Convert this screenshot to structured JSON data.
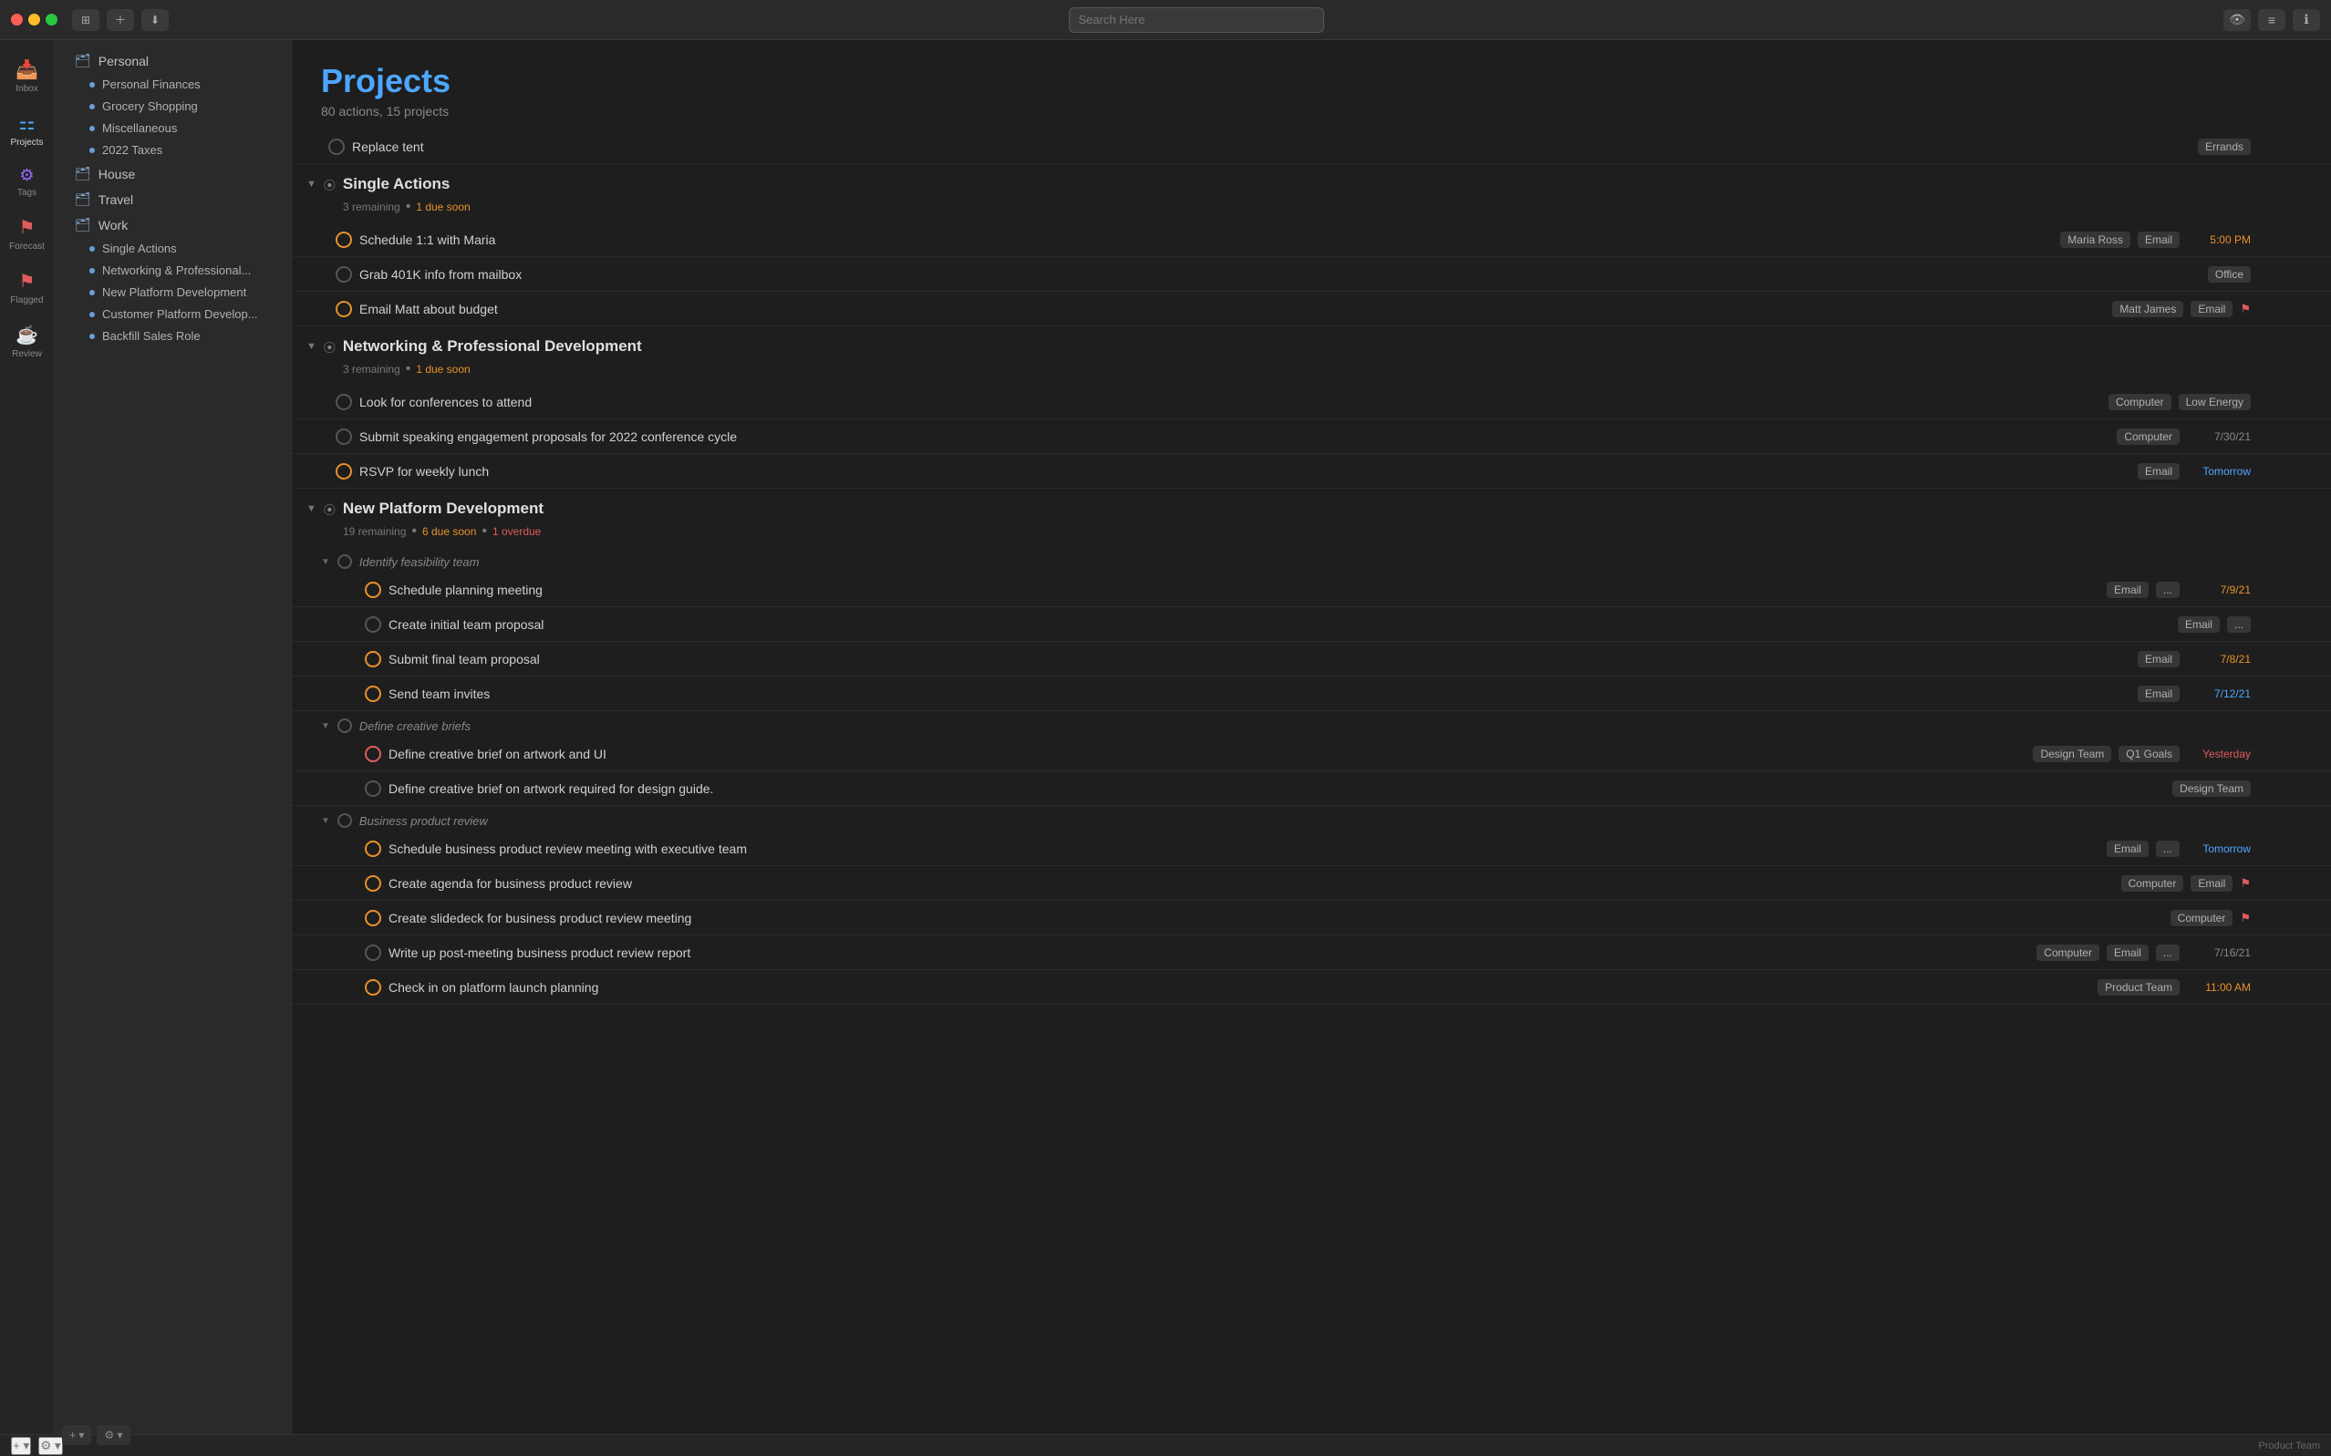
{
  "titlebar": {
    "search_placeholder": "Search Here",
    "buttons": [
      "⊞",
      "＋",
      "⬇"
    ]
  },
  "icon_sidebar": {
    "items": [
      {
        "id": "inbox",
        "icon": "📥",
        "label": "Inbox"
      },
      {
        "id": "projects",
        "icon": "⚏",
        "label": "Projects",
        "active": true
      },
      {
        "id": "tags",
        "icon": "⚙",
        "label": "Tags"
      },
      {
        "id": "forecast",
        "icon": "⚑",
        "label": "Forecast"
      },
      {
        "id": "flagged",
        "icon": "⚑",
        "label": "Flagged"
      },
      {
        "id": "review",
        "icon": "☕",
        "label": "Review"
      }
    ]
  },
  "nav_sidebar": {
    "personal_group": {
      "label": "Personal",
      "items": [
        {
          "label": "Personal Finances"
        },
        {
          "label": "Grocery Shopping"
        },
        {
          "label": "Miscellaneous"
        },
        {
          "label": "2022 Taxes"
        }
      ]
    },
    "house": {
      "label": "House"
    },
    "travel": {
      "label": "Travel"
    },
    "work_group": {
      "label": "Work",
      "items": [
        {
          "label": "Single Actions"
        },
        {
          "label": "Networking & Professional..."
        },
        {
          "label": "New Platform Development"
        },
        {
          "label": "Customer Platform Develop..."
        },
        {
          "label": "Backfill Sales Role"
        }
      ]
    }
  },
  "content": {
    "title": "Projects",
    "subtitle": "80 actions, 15 projects",
    "standalone_action": {
      "title": "Replace tent",
      "tags": [
        "Errands"
      ]
    },
    "sections": [
      {
        "id": "single-actions",
        "title": "Single Actions",
        "remaining": "3 remaining",
        "due_soon": "1 due soon",
        "actions": [
          {
            "title": "Schedule 1:1 with Maria",
            "tags": [
              "Maria Ross",
              "Email"
            ],
            "date": "5:00 PM",
            "date_class": "orange",
            "check_class": "orange",
            "flagged": false
          },
          {
            "title": "Grab 401K info from mailbox",
            "tags": [
              "Office"
            ],
            "date": "",
            "date_class": "",
            "check_class": "",
            "flagged": false
          },
          {
            "title": "Email Matt about budget",
            "tags": [
              "Matt James",
              "Email"
            ],
            "date": "",
            "date_class": "",
            "check_class": "orange",
            "flagged": true
          }
        ]
      },
      {
        "id": "networking",
        "title": "Networking & Professional Development",
        "remaining": "3 remaining",
        "due_soon": "1 due soon",
        "actions": [
          {
            "title": "Look for conferences to attend",
            "tags": [
              "Computer",
              "Low Energy"
            ],
            "date": "",
            "date_class": "",
            "check_class": "",
            "flagged": false
          },
          {
            "title": "Submit speaking engagement proposals for 2022 conference cycle",
            "tags": [
              "Computer"
            ],
            "date": "7/30/21",
            "date_class": "",
            "check_class": "",
            "flagged": false
          },
          {
            "title": "RSVP for weekly lunch",
            "tags": [
              "Email"
            ],
            "date": "Tomorrow",
            "date_class": "blue",
            "check_class": "orange",
            "flagged": false
          }
        ]
      },
      {
        "id": "new-platform-development",
        "title": "New Platform Development",
        "remaining": "19 remaining",
        "due_soon": "6 due soon",
        "overdue": "1 overdue",
        "sub_sections": [
          {
            "title": "Identify feasibility team",
            "actions": [
              {
                "title": "Schedule planning meeting",
                "tags": [
                  "Email",
                  "..."
                ],
                "date": "7/9/21",
                "date_class": "orange",
                "check_class": "orange",
                "flagged": false
              },
              {
                "title": "Create initial team proposal",
                "tags": [
                  "Email",
                  "..."
                ],
                "date": "",
                "date_class": "",
                "check_class": "",
                "flagged": false
              },
              {
                "title": "Submit final team proposal",
                "tags": [
                  "Email"
                ],
                "date": "7/8/21",
                "date_class": "orange",
                "check_class": "orange",
                "flagged": false
              },
              {
                "title": "Send team invites",
                "tags": [
                  "Email"
                ],
                "date": "7/12/21",
                "date_class": "blue",
                "check_class": "orange",
                "flagged": false
              }
            ]
          },
          {
            "title": "Define creative briefs",
            "actions": [
              {
                "title": "Define creative brief on artwork and UI",
                "tags": [
                  "Design Team",
                  "Q1 Goals"
                ],
                "date": "Yesterday",
                "date_class": "red",
                "check_class": "red",
                "flagged": false
              },
              {
                "title": "Define creative brief on artwork required for design guide.",
                "tags": [
                  "Design Team"
                ],
                "date": "",
                "date_class": "",
                "check_class": "",
                "flagged": false
              }
            ]
          },
          {
            "title": "Business product review",
            "actions": [
              {
                "title": "Schedule business product review meeting with executive team",
                "tags": [
                  "Email",
                  "..."
                ],
                "date": "Tomorrow",
                "date_class": "blue",
                "check_class": "orange",
                "flagged": false
              },
              {
                "title": "Create agenda for business product review",
                "tags": [
                  "Computer",
                  "Email"
                ],
                "date": "",
                "date_class": "",
                "check_class": "orange",
                "flagged": true
              },
              {
                "title": "Create slidedeck for business product review meeting",
                "tags": [
                  "Computer"
                ],
                "date": "",
                "date_class": "",
                "check_class": "orange",
                "flagged": true
              },
              {
                "title": "Write up post-meeting business product review report",
                "tags": [
                  "Computer",
                  "Email",
                  "..."
                ],
                "date": "7/16/21",
                "date_class": "",
                "check_class": "",
                "flagged": false
              },
              {
                "title": "Check in on platform launch planning",
                "tags": [
                  "Product Team"
                ],
                "date": "11:00 AM",
                "date_class": "orange",
                "check_class": "orange",
                "flagged": false
              }
            ]
          }
        ]
      }
    ]
  },
  "statusbar": {
    "left_btn": "+ ▾",
    "right_btn": "⚙ ▾",
    "product_team": "Product Team"
  }
}
